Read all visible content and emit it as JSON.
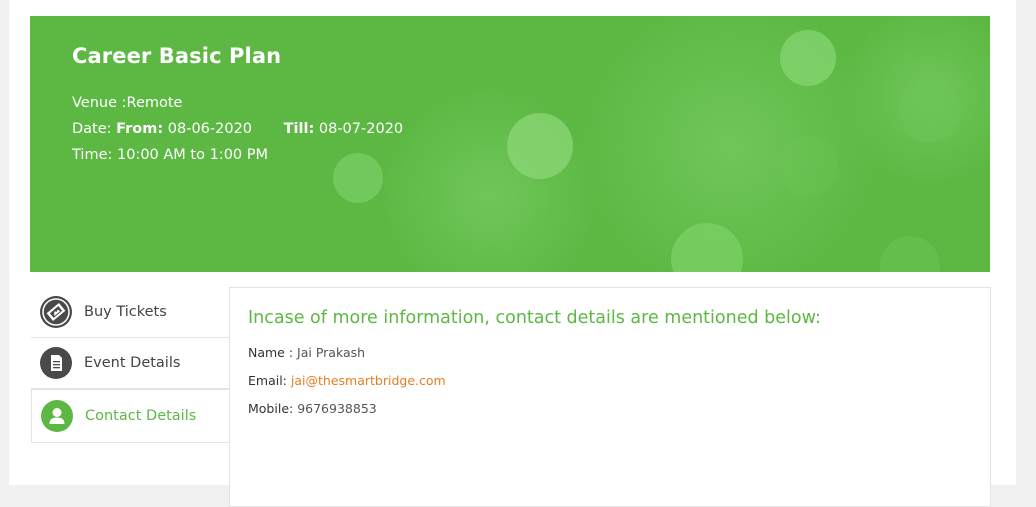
{
  "hero": {
    "title": "Career Basic Plan",
    "venue_label": "Venue :",
    "venue_value": "Remote",
    "date_label": "Date:",
    "from_label": "From:",
    "from_value": "08-06-2020",
    "till_label": "Till:",
    "till_value": "08-07-2020",
    "time_label": "Time:",
    "time_value": "10:00 AM to 1:00 PM",
    "background_color": "#5cb843"
  },
  "tabs": [
    {
      "label": "Buy Tickets",
      "icon": "ticket-icon",
      "active": false
    },
    {
      "label": "Event Details",
      "icon": "document-icon",
      "active": false
    },
    {
      "label": "Contact Details",
      "icon": "user-icon",
      "active": true
    }
  ],
  "contact": {
    "heading": "Incase of more information, contact details are mentioned below:",
    "name_label": "Name :",
    "name_value": "Jai Prakash",
    "email_label": "Email:",
    "email_value": "jai@thesmartbridge.com",
    "mobile_label": "Mobile:",
    "mobile_value": "9676938853"
  },
  "colors": {
    "accent": "#5cb843",
    "link": "#e67e22",
    "icon_dark": "#4a4a4a"
  }
}
